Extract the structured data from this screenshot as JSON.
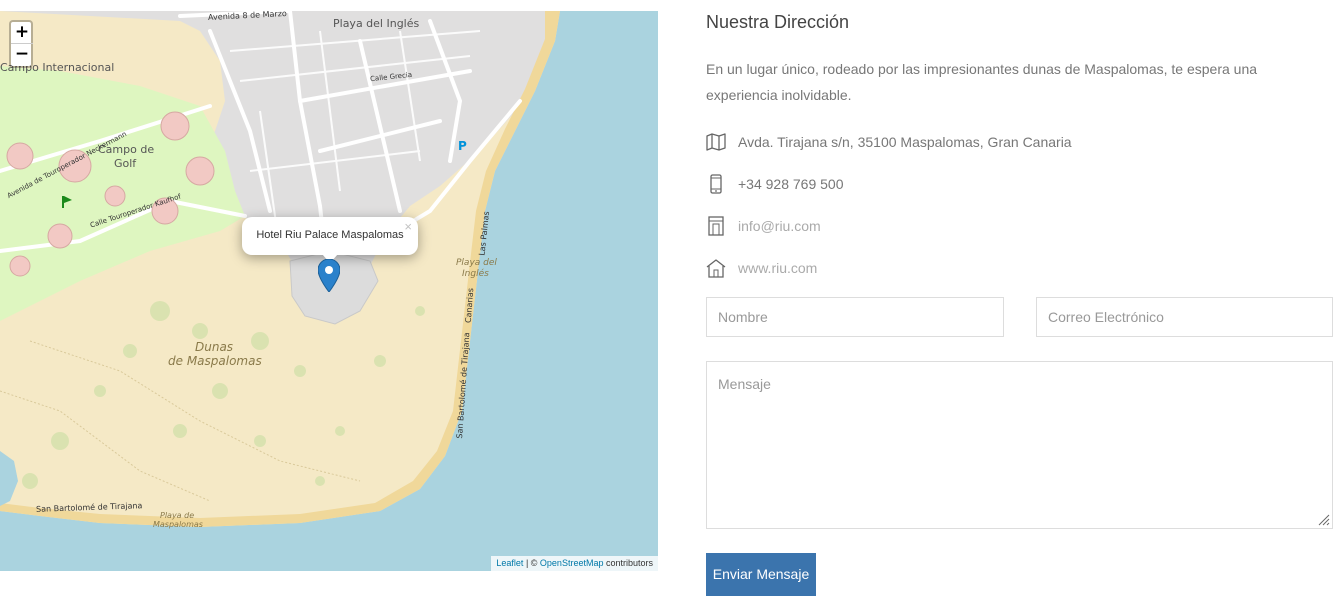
{
  "map": {
    "zoom_in": "+",
    "zoom_out": "−",
    "popup_text": "Hotel Riu Palace Maspalomas",
    "popup_close": "×",
    "attribution": {
      "leaflet": "Leaflet",
      "separator": " | © ",
      "osm": "OpenStreetMap",
      "suffix": " contributors"
    },
    "labels": {
      "avenida_marzo": "Avenida 8 de Marzo",
      "playa_ingles_top": "Playa del Inglés",
      "campo_internacional": "Campo Internacional",
      "campo_golf_1": "Campo de",
      "campo_golf_2": "Golf",
      "calle_grecia": "Calle Grecia",
      "playa_ingles_beach_1": "Playa del",
      "playa_ingles_beach_2": "Inglés",
      "dunas_1": "Dunas",
      "dunas_2": "de Maspalomas",
      "san_bartolome_road": "San Bartolomé de Tirajana",
      "san_bartolome_vertical": "San Bartolomé de Tirajana",
      "canarias": "Canarias",
      "las_palmas": "Las Palmas",
      "playa_maspalomas_1": "Playa de",
      "playa_maspalomas_2": "Maspalomas",
      "parking": "P",
      "calle_touroperador": "Calle Touroperador Kaufhof",
      "avenida_touroperador": "Avenida de Touroperador Neckermann"
    },
    "colors": {
      "water": "#aad3df",
      "sand": "#f5e9c6",
      "golf": "#def6c0",
      "urban": "#e0dfdf",
      "marker": "#2a81cb"
    }
  },
  "contact": {
    "title": "Nuestra Dirección",
    "description": "En un lugar único, rodeado por las impresionantes dunas de Maspalomas, te espera una experiencia inolvidable.",
    "items": [
      {
        "icon": "map-icon",
        "value": "Avda. Tirajana s/n, 35100 Maspalomas, Gran Canaria"
      },
      {
        "icon": "phone-icon",
        "value": "+34 928 769 500"
      },
      {
        "icon": "building-icon",
        "value": "info@riu.com"
      },
      {
        "icon": "home-icon",
        "value": "www.riu.com"
      }
    ],
    "form": {
      "name_placeholder": "Nombre",
      "email_placeholder": "Correo Electrónico",
      "message_placeholder": "Mensaje",
      "submit_label": "Enviar Mensaje"
    },
    "accent_color": "#3b74ad"
  }
}
